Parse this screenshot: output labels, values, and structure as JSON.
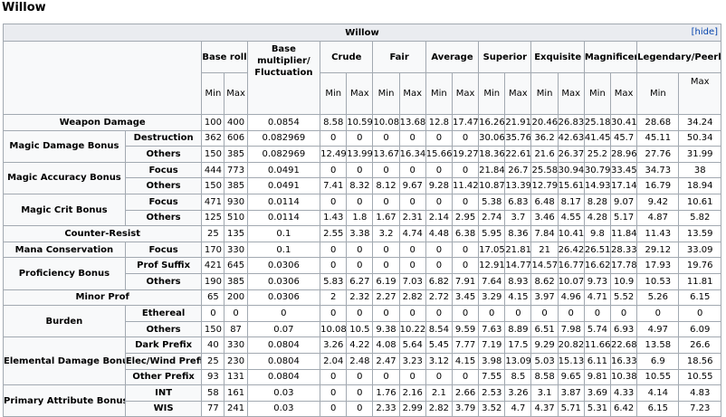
{
  "page_title": "Willow",
  "table": {
    "caption": "Willow",
    "hide_label": "[hide]",
    "headers": {
      "base_rolls": "Base rolls",
      "multiplier": "Base multiplier/ Fluctuation",
      "crude": "Crude",
      "fair": "Fair",
      "average": "Average",
      "superior": "Superior",
      "exquisite": "Exquisite",
      "magnificent": "Magnificent",
      "legendary": "Legendary/Peerless",
      "min": "Min",
      "max": "Max"
    },
    "rows": [
      {
        "group": "Weapon Damage",
        "sub": "",
        "cells": [
          "100",
          "400",
          "0.0854",
          "8.58",
          "10.59",
          "10.08",
          "13.68",
          "12.8",
          "17.47",
          "16.26",
          "21.91",
          "20.46",
          "26.83",
          "25.18",
          "30.41",
          "28.68",
          "34.24"
        ]
      },
      {
        "group": "Magic Damage Bonus",
        "sub": "Destruction",
        "cells": [
          "362",
          "606",
          "0.082969",
          "0",
          "0",
          "0",
          "0",
          "0",
          "0",
          "30.06",
          "35.76",
          "36.2",
          "42.63",
          "41.45",
          "45.7",
          "45.11",
          "50.34"
        ]
      },
      {
        "group": "",
        "sub": "Others",
        "cells": [
          "150",
          "385",
          "0.082969",
          "12.49",
          "13.99",
          "13.67",
          "16.34",
          "15.66",
          "19.27",
          "18.36",
          "22.61",
          "21.6",
          "26.37",
          "25.2",
          "28.96",
          "27.76",
          "31.99"
        ]
      },
      {
        "group": "Magic Accuracy Bonus",
        "sub": "Focus",
        "cells": [
          "444",
          "773",
          "0.0491",
          "0",
          "0",
          "0",
          "0",
          "0",
          "0",
          "21.84",
          "26.7",
          "25.58",
          "30.94",
          "30.79",
          "33.45",
          "34.73",
          "38"
        ]
      },
      {
        "group": "",
        "sub": "Others",
        "cells": [
          "150",
          "385",
          "0.0491",
          "7.41",
          "8.32",
          "8.12",
          "9.67",
          "9.28",
          "11.42",
          "10.87",
          "13.39",
          "12.79",
          "15.61",
          "14.93",
          "17.14",
          "16.79",
          "18.94"
        ]
      },
      {
        "group": "Magic Crit Bonus",
        "sub": "Focus",
        "cells": [
          "471",
          "930",
          "0.0114",
          "0",
          "0",
          "0",
          "0",
          "0",
          "0",
          "5.38",
          "6.83",
          "6.48",
          "8.17",
          "8.28",
          "9.07",
          "9.42",
          "10.61"
        ]
      },
      {
        "group": "",
        "sub": "Others",
        "cells": [
          "125",
          "510",
          "0.0114",
          "1.43",
          "1.8",
          "1.67",
          "2.31",
          "2.14",
          "2.95",
          "2.74",
          "3.7",
          "3.46",
          "4.55",
          "4.28",
          "5.17",
          "4.87",
          "5.82"
        ]
      },
      {
        "group": "Counter-Resist",
        "sub": "",
        "cells": [
          "25",
          "135",
          "0.1",
          "2.55",
          "3.38",
          "3.2",
          "4.74",
          "4.48",
          "6.38",
          "5.95",
          "8.36",
          "7.84",
          "10.41",
          "9.8",
          "11.84",
          "11.43",
          "13.59"
        ]
      },
      {
        "group": "Mana Conservation",
        "sub": "Focus",
        "cells": [
          "170",
          "330",
          "0.1",
          "0",
          "0",
          "0",
          "0",
          "0",
          "0",
          "17.05",
          "21.81",
          "21",
          "26.42",
          "26.51",
          "28.33",
          "29.12",
          "33.09"
        ]
      },
      {
        "group": "Proficiency Bonus",
        "sub": "Prof Suffix",
        "cells": [
          "421",
          "645",
          "0.0306",
          "0",
          "0",
          "0",
          "0",
          "0",
          "0",
          "12.91",
          "14.77",
          "14.57",
          "16.77",
          "16.62",
          "17.78",
          "17.93",
          "19.76"
        ]
      },
      {
        "group": "",
        "sub": "Others",
        "cells": [
          "190",
          "385",
          "0.0306",
          "5.83",
          "6.27",
          "6.19",
          "7.03",
          "6.82",
          "7.91",
          "7.64",
          "8.93",
          "8.62",
          "10.07",
          "9.73",
          "10.9",
          "10.53",
          "11.81"
        ]
      },
      {
        "group": "Minor Prof",
        "sub": "",
        "cells": [
          "65",
          "200",
          "0.0306",
          "2",
          "2.32",
          "2.27",
          "2.82",
          "2.72",
          "3.45",
          "3.29",
          "4.15",
          "3.97",
          "4.96",
          "4.71",
          "5.52",
          "5.26",
          "6.15"
        ]
      },
      {
        "group": "Burden",
        "sub": "Ethereal",
        "cells": [
          "0",
          "0",
          "0",
          "0",
          "0",
          "0",
          "0",
          "0",
          "0",
          "0",
          "0",
          "0",
          "0",
          "0",
          "0",
          "0",
          "0"
        ]
      },
      {
        "group": "",
        "sub": "Others",
        "cells": [
          "150",
          "87",
          "0.07",
          "10.08",
          "10.5",
          "9.38",
          "10.22",
          "8.54",
          "9.59",
          "7.63",
          "8.89",
          "6.51",
          "7.98",
          "5.74",
          "6.93",
          "4.97",
          "6.09"
        ]
      },
      {
        "group": "Elemental Damage Bonuses",
        "sub": "Dark Prefix",
        "cells": [
          "40",
          "330",
          "0.0804",
          "3.26",
          "4.22",
          "4.08",
          "5.64",
          "5.45",
          "7.77",
          "7.19",
          "17.5",
          "9.29",
          "20.82",
          "11.66",
          "22.68",
          "13.58",
          "26.6"
        ]
      },
      {
        "group": "",
        "sub": "Elec/Wind Prefix",
        "cells": [
          "25",
          "230",
          "0.0804",
          "2.04",
          "2.48",
          "2.47",
          "3.23",
          "3.12",
          "4.15",
          "3.98",
          "13.09",
          "5.03",
          "15.13",
          "6.11",
          "16.33",
          "6.9",
          "18.56"
        ]
      },
      {
        "group": "",
        "sub": "Other Prefix",
        "cells": [
          "93",
          "131",
          "0.0804",
          "0",
          "0",
          "0",
          "0",
          "0",
          "0",
          "7.55",
          "8.5",
          "8.58",
          "9.65",
          "9.81",
          "10.38",
          "10.55",
          "10.55"
        ]
      },
      {
        "group": "Primary Attribute Bonuses",
        "sub": "INT",
        "cells": [
          "58",
          "161",
          "0.03",
          "0",
          "0",
          "1.76",
          "2.16",
          "2.1",
          "2.66",
          "2.53",
          "3.26",
          "3.1",
          "3.87",
          "3.69",
          "4.33",
          "4.14",
          "4.83"
        ]
      },
      {
        "group": "",
        "sub": "WIS",
        "cells": [
          "77",
          "241",
          "0.03",
          "0",
          "0",
          "2.33",
          "2.99",
          "2.82",
          "3.79",
          "3.52",
          "4.7",
          "4.37",
          "5.71",
          "5.31",
          "6.42",
          "6.15",
          "7.23"
        ]
      }
    ]
  }
}
